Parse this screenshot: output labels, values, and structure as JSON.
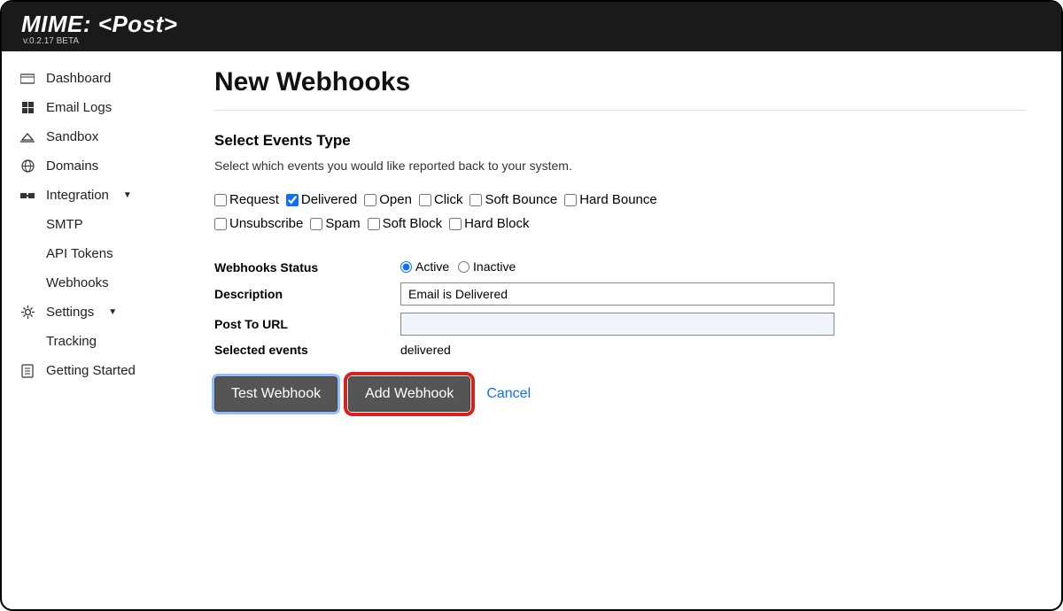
{
  "header": {
    "brand": "MIME: <Post>",
    "version": "v.0.2.17 BETA"
  },
  "sidebar": {
    "items": [
      {
        "label": "Dashboard",
        "icon": "dashboard"
      },
      {
        "label": "Email Logs",
        "icon": "logs"
      },
      {
        "label": "Sandbox",
        "icon": "sandbox"
      },
      {
        "label": "Domains",
        "icon": "globe"
      },
      {
        "label": "Integration",
        "icon": "integration",
        "caret": true
      },
      {
        "label": "Settings",
        "icon": "gear",
        "caret": true
      },
      {
        "label": "Getting Started",
        "icon": "doc"
      }
    ],
    "integration_sub": [
      {
        "label": "SMTP"
      },
      {
        "label": "API Tokens"
      },
      {
        "label": "Webhooks"
      }
    ],
    "settings_sub": [
      {
        "label": "Tracking"
      }
    ]
  },
  "page": {
    "title": "New Webhooks",
    "events_title": "Select Events Type",
    "events_desc": "Select which events you would like reported back to your system.",
    "events": [
      {
        "label": "Request",
        "checked": false
      },
      {
        "label": "Delivered",
        "checked": true
      },
      {
        "label": "Open",
        "checked": false
      },
      {
        "label": "Click",
        "checked": false
      },
      {
        "label": "Soft Bounce",
        "checked": false
      },
      {
        "label": "Hard Bounce",
        "checked": false
      },
      {
        "label": "Unsubscribe",
        "checked": false
      },
      {
        "label": "Spam",
        "checked": false
      },
      {
        "label": "Soft Block",
        "checked": false
      },
      {
        "label": "Hard Block",
        "checked": false
      }
    ],
    "form": {
      "status_label": "Webhooks Status",
      "status_active": "Active",
      "status_inactive": "Inactive",
      "desc_label": "Description",
      "desc_value": "Email is Delivered",
      "url_label": "Post To URL",
      "url_value": "",
      "selected_label": "Selected events",
      "selected_value": "delivered"
    },
    "buttons": {
      "test": "Test Webhook",
      "add": "Add Webhook",
      "cancel": "Cancel"
    }
  }
}
